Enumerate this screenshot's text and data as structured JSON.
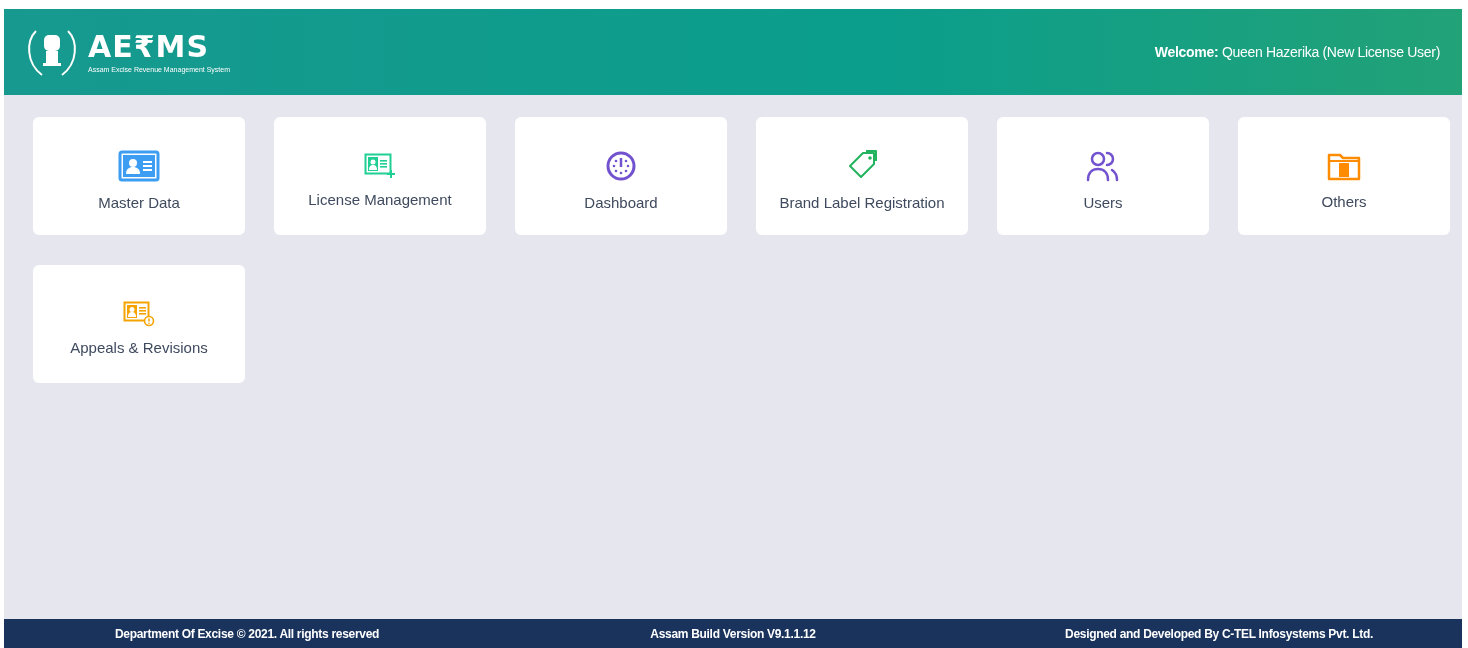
{
  "header": {
    "logo_title": "AE₹MS",
    "logo_subtitle": "Assam Excise Revenue Management System",
    "welcome": "**Welcome:** Queen Hazerika (New License User)"
  },
  "tiles": [
    {
      "label": "Master Data",
      "kind": "id-card"
    },
    {
      "label": "License Management",
      "kind": "id-card-plus"
    },
    {
      "label": "Dashboard",
      "kind": "gauge"
    },
    {
      "label": "Brand Label Registration",
      "kind": "tag"
    },
    {
      "label": "Users",
      "kind": "users"
    },
    {
      "label": "Others",
      "kind": "folder"
    },
    {
      "label": "Appeals & Revisions",
      "kind": "id-card-alert"
    }
  ],
  "footer": {
    "copyright": "Department Of Excise © 2021. All rights reserved",
    "version": "Assam Build Version V9.1.1.12",
    "credits": "Designed and Developed By C-TEL Infosystems Pvt. Ltd."
  }
}
